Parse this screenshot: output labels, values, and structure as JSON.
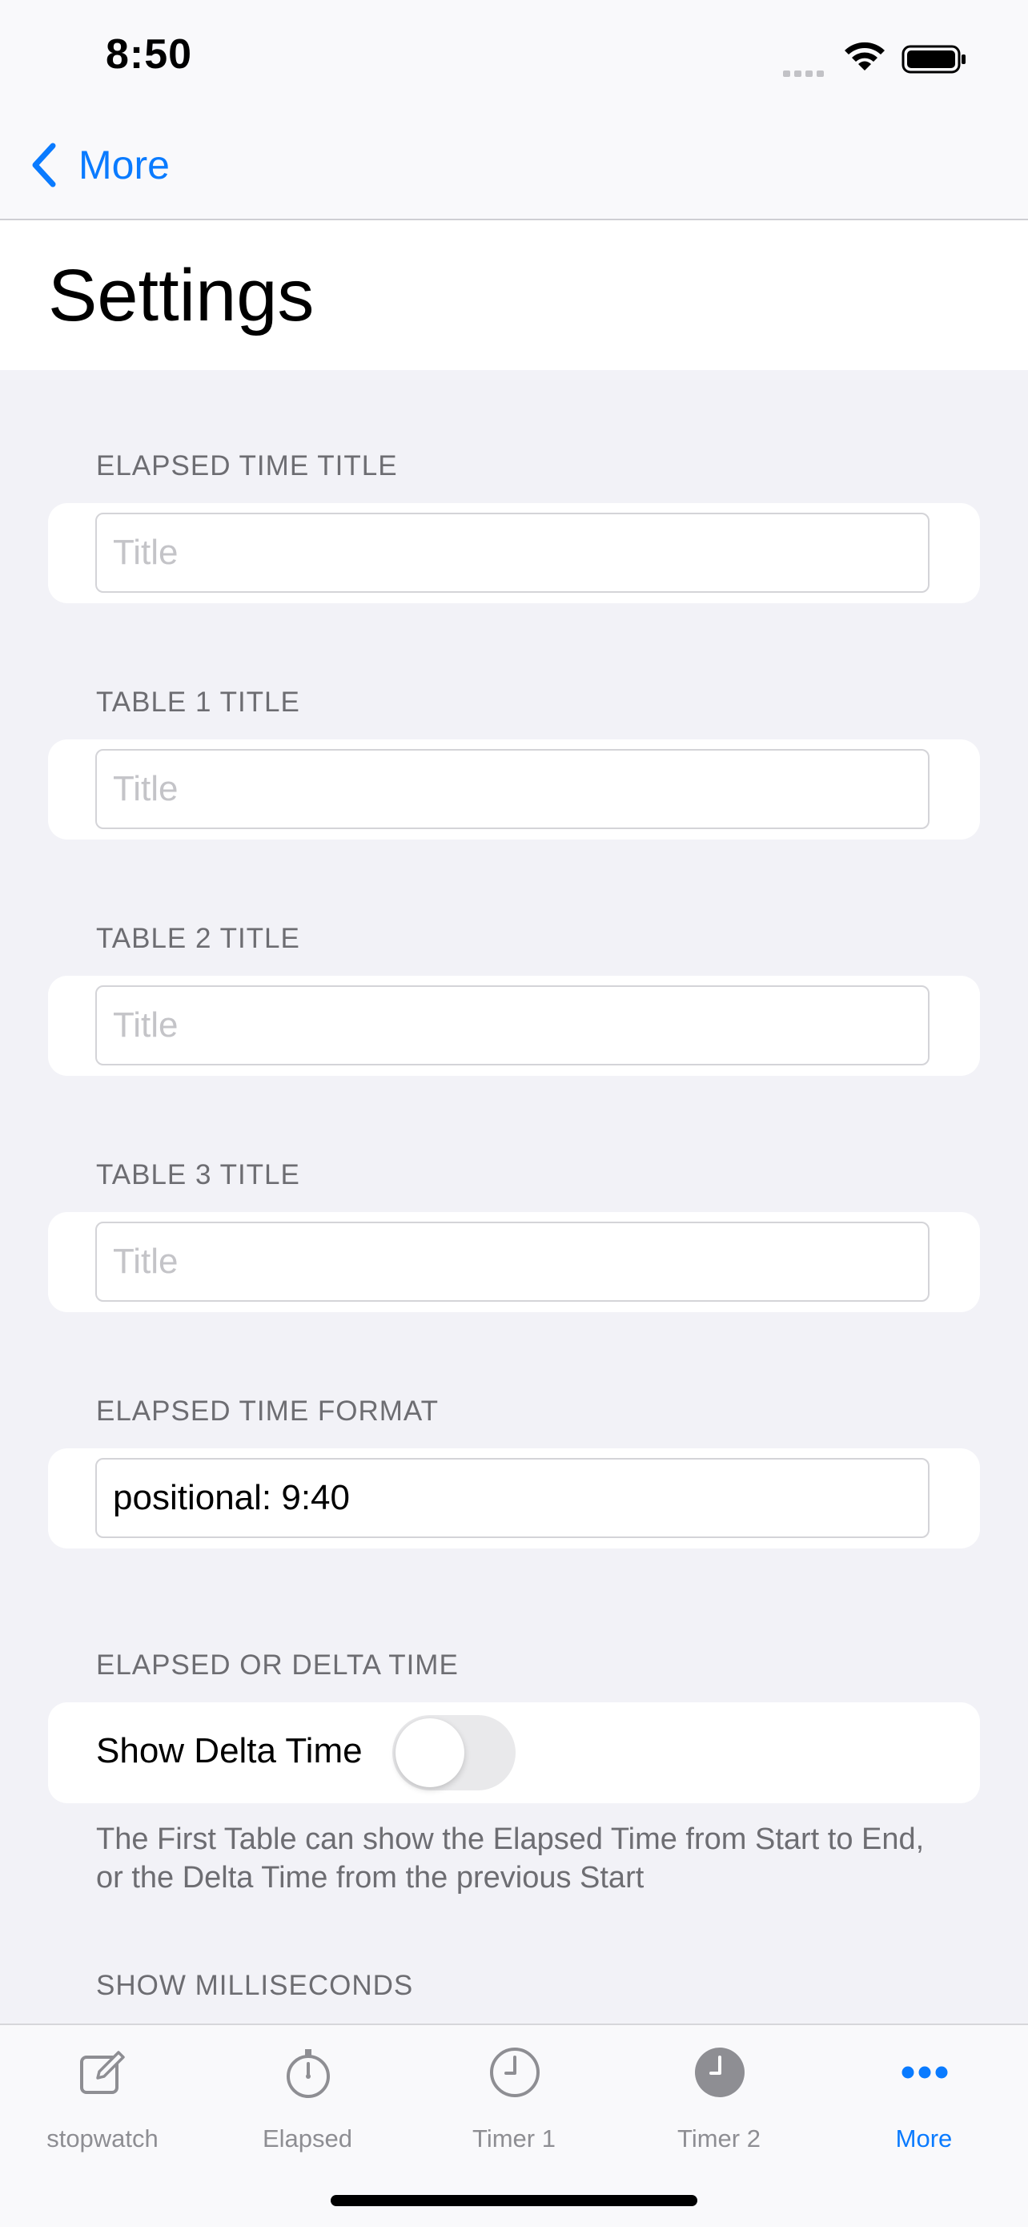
{
  "status": {
    "time": "8:50"
  },
  "nav": {
    "back_label": "More"
  },
  "page": {
    "title": "Settings"
  },
  "sections": [
    {
      "header": "ELAPSED TIME TITLE",
      "placeholder": "Title",
      "value": ""
    },
    {
      "header": "TABLE 1 TITLE",
      "placeholder": "Title",
      "value": ""
    },
    {
      "header": "TABLE 2 TITLE",
      "placeholder": "Title",
      "value": ""
    },
    {
      "header": "TABLE 3 TITLE",
      "placeholder": "Title",
      "value": ""
    },
    {
      "header": "ELAPSED TIME FORMAT",
      "placeholder": "",
      "value": "positional: 9:40"
    }
  ],
  "delta": {
    "header": "ELAPSED OR DELTA TIME",
    "label": "Show Delta Time",
    "enabled": false,
    "footnote": "The First Table can show the Elapsed Time from Start to End, or the Delta Time from the previous Start"
  },
  "milliseconds": {
    "header": "SHOW MILLISECONDS"
  },
  "tabbar": {
    "items": [
      {
        "label": "stopwatch",
        "icon": "compose-icon",
        "active": false
      },
      {
        "label": "Elapsed",
        "icon": "stopwatch-icon",
        "active": false
      },
      {
        "label": "Timer 1",
        "icon": "clock-outline-icon",
        "active": false
      },
      {
        "label": "Timer 2",
        "icon": "clock-filled-icon",
        "active": false
      },
      {
        "label": "More",
        "icon": "more-icon",
        "active": true
      }
    ]
  },
  "colors": {
    "accent": "#0a7bff",
    "background": "#f2f2f7",
    "secondary_text": "#6d6d72"
  }
}
